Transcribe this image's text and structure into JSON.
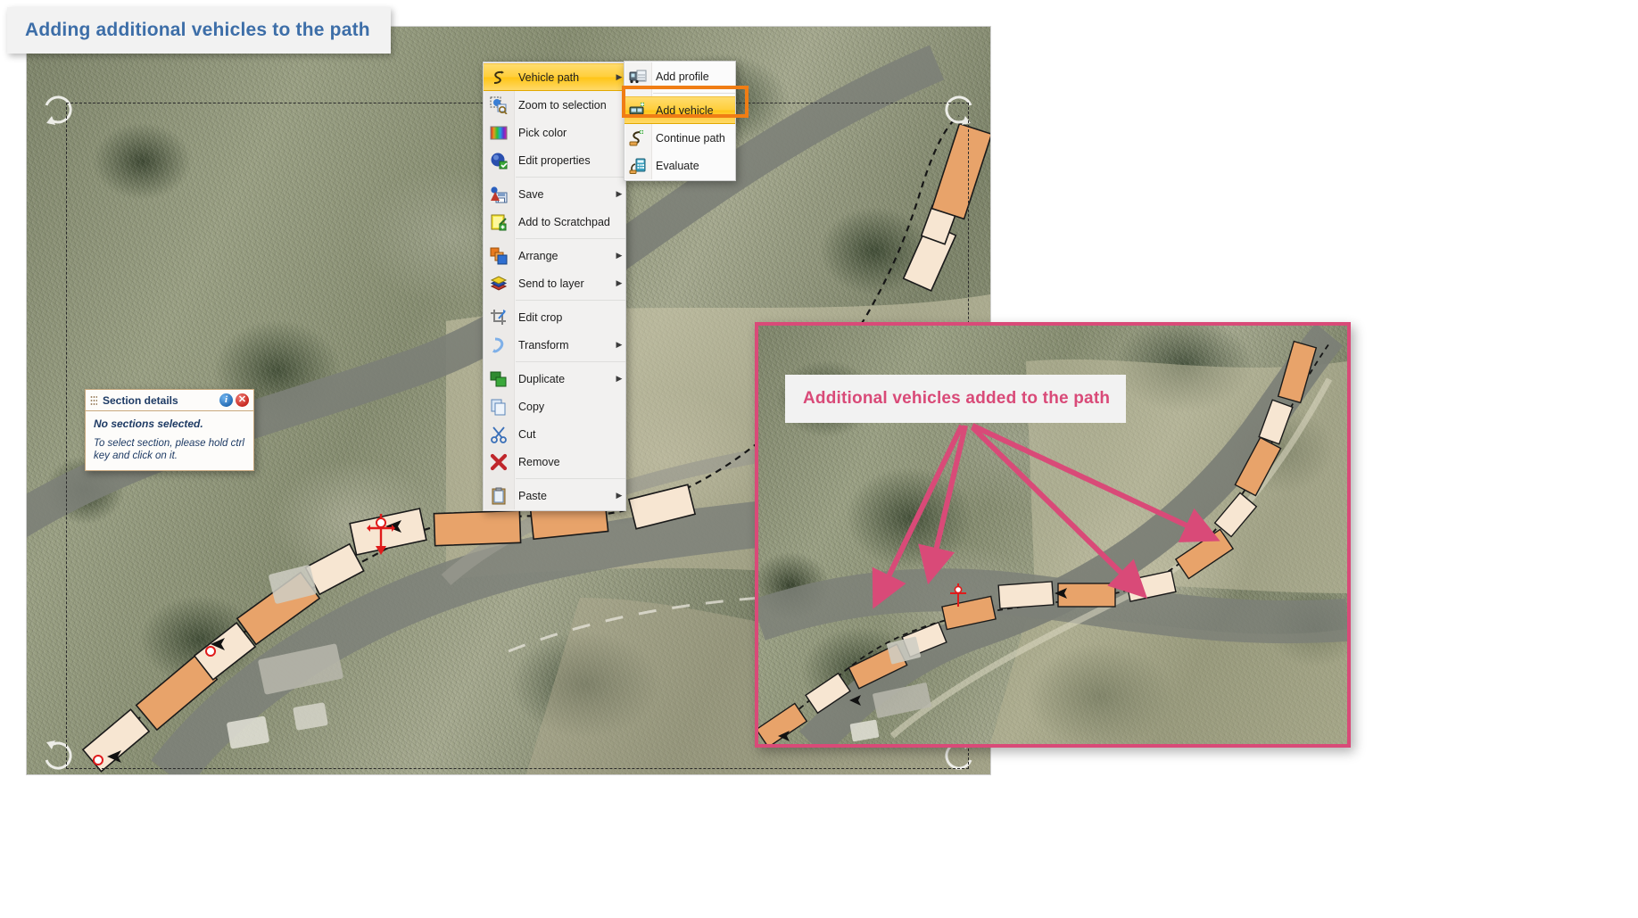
{
  "heading_callout": {
    "text": "Adding additional vehicles to the path",
    "color": "#3d6ea8"
  },
  "section_details": {
    "title": "Section details",
    "info_icon": "info-icon",
    "close_icon": "close-icon",
    "grip_icon": "drag-grip-icon",
    "line1": "No sections selected.",
    "line2": "To select section, please hold ctrl key and click on it.",
    "text_color": "#1d3a64"
  },
  "context_menu": {
    "highlight_color": "#ffc517",
    "items": [
      {
        "label": "Vehicle path",
        "icon": "vehicle-path-icon",
        "submenu": true,
        "selected": true,
        "separator_after": false
      },
      {
        "label": "Zoom to selection",
        "icon": "zoom-selection-icon",
        "submenu": false,
        "selected": false,
        "separator_after": false
      },
      {
        "label": "Pick color",
        "icon": "pick-color-icon",
        "submenu": false,
        "selected": false,
        "separator_after": false
      },
      {
        "label": "Edit properties",
        "icon": "edit-properties-icon",
        "submenu": false,
        "selected": false,
        "separator_after": true
      },
      {
        "label": "Save",
        "icon": "save-icon",
        "submenu": true,
        "selected": false,
        "separator_after": false
      },
      {
        "label": "Add to Scratchpad",
        "icon": "scratchpad-icon",
        "submenu": false,
        "selected": false,
        "separator_after": true
      },
      {
        "label": "Arrange",
        "icon": "arrange-icon",
        "submenu": true,
        "selected": false,
        "separator_after": false
      },
      {
        "label": "Send to layer",
        "icon": "layers-icon",
        "submenu": true,
        "selected": false,
        "separator_after": true
      },
      {
        "label": "Edit crop",
        "icon": "crop-icon",
        "submenu": false,
        "selected": false,
        "separator_after": false
      },
      {
        "label": "Transform",
        "icon": "transform-icon",
        "submenu": true,
        "selected": false,
        "separator_after": true
      },
      {
        "label": "Duplicate",
        "icon": "duplicate-icon",
        "submenu": true,
        "selected": false,
        "separator_after": false
      },
      {
        "label": "Copy",
        "icon": "copy-icon",
        "submenu": false,
        "selected": false,
        "separator_after": false
      },
      {
        "label": "Cut",
        "icon": "cut-scissors-icon",
        "submenu": false,
        "selected": false,
        "separator_after": false
      },
      {
        "label": "Remove",
        "icon": "remove-x-icon",
        "submenu": false,
        "selected": false,
        "separator_after": true
      },
      {
        "label": "Paste",
        "icon": "paste-clipboard-icon",
        "submenu": true,
        "selected": false,
        "separator_after": false
      }
    ]
  },
  "sub_menu": {
    "parent": "Vehicle path",
    "items": [
      {
        "label": "Add profile",
        "icon": "add-profile-icon",
        "selected": false
      },
      {
        "label": "Add vehicle",
        "icon": "add-vehicle-icon",
        "selected": true
      },
      {
        "label": "Continue path",
        "icon": "continue-path-icon",
        "selected": false
      },
      {
        "label": "Evaluate",
        "icon": "evaluate-icon",
        "selected": false
      }
    ],
    "highlight_ring_color": "#f07d14"
  },
  "inset": {
    "callout_text": "Additional vehicles added to the path",
    "border_color": "#d94a78",
    "arrow_color": "#d94a78",
    "arrow_count": 4
  },
  "map": {
    "vehicle_fill": "#e8a36a",
    "trailer_fill": "#f7e6d2",
    "path_stroke": "#1a1a1a",
    "anchor_color": "#e01b1b",
    "selection_outline": "#2b2b2b"
  }
}
